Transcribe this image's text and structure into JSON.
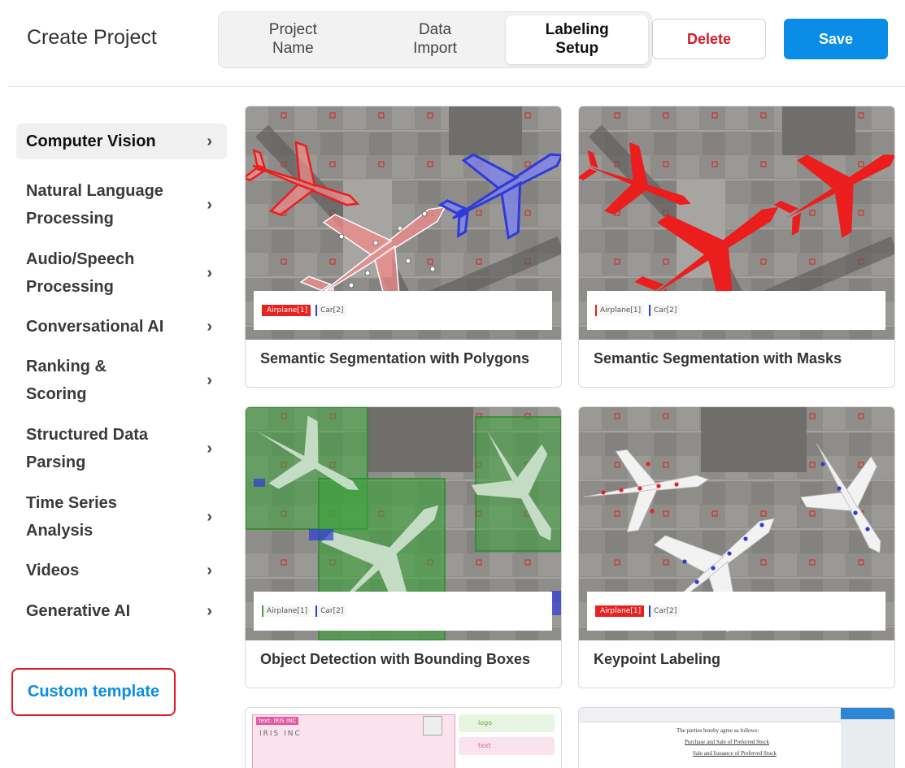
{
  "header": {
    "title": "Create Project",
    "steps": [
      "Project\nName",
      "Data\nImport",
      "Labeling\nSetup"
    ],
    "active_step": 2,
    "delete_label": "Delete",
    "save_label": "Save"
  },
  "sidebar": {
    "items": [
      {
        "label": "Computer Vision"
      },
      {
        "label": "Natural Language\nProcessing"
      },
      {
        "label": "Audio/Speech\nProcessing"
      },
      {
        "label": "Conversational AI"
      },
      {
        "label": "Ranking &\nScoring"
      },
      {
        "label": "Structured Data\nParsing"
      },
      {
        "label": "Time Series\nAnalysis"
      },
      {
        "label": "Videos"
      },
      {
        "label": "Generative AI"
      }
    ],
    "custom_template_label": "Custom template"
  },
  "templates": [
    {
      "title": "Semantic Segmentation with Polygons",
      "tags": [
        "Airplane[1]",
        "Car[2]"
      ]
    },
    {
      "title": "Semantic Segmentation with Masks",
      "tags": [
        "Airplane[1]",
        "Car[2]"
      ]
    },
    {
      "title": "Object Detection with Bounding Boxes",
      "tags": [
        "Airplane[1]",
        "Car[2]"
      ]
    },
    {
      "title": "Keypoint Labeling",
      "tags": [
        "Airplane[1]",
        "Car[2]"
      ]
    }
  ],
  "partial_templates": [
    {
      "texts": [
        "text: IRIS INC",
        "IRIS INC",
        "logo",
        "text"
      ]
    },
    {
      "texts": [
        "The parties hereby agree as follows:",
        "Purchase and Sale of Preferred Stock",
        "Sale and Issuance of Preferred Stock"
      ]
    }
  ],
  "colors": {
    "accent": "#0a8de6",
    "danger": "#d4192c",
    "airplane": "#e8201f",
    "car": "#2d3bd8",
    "bbox": "#3aa33a"
  },
  "icons": {
    "chevron": "chevron-right-icon"
  }
}
